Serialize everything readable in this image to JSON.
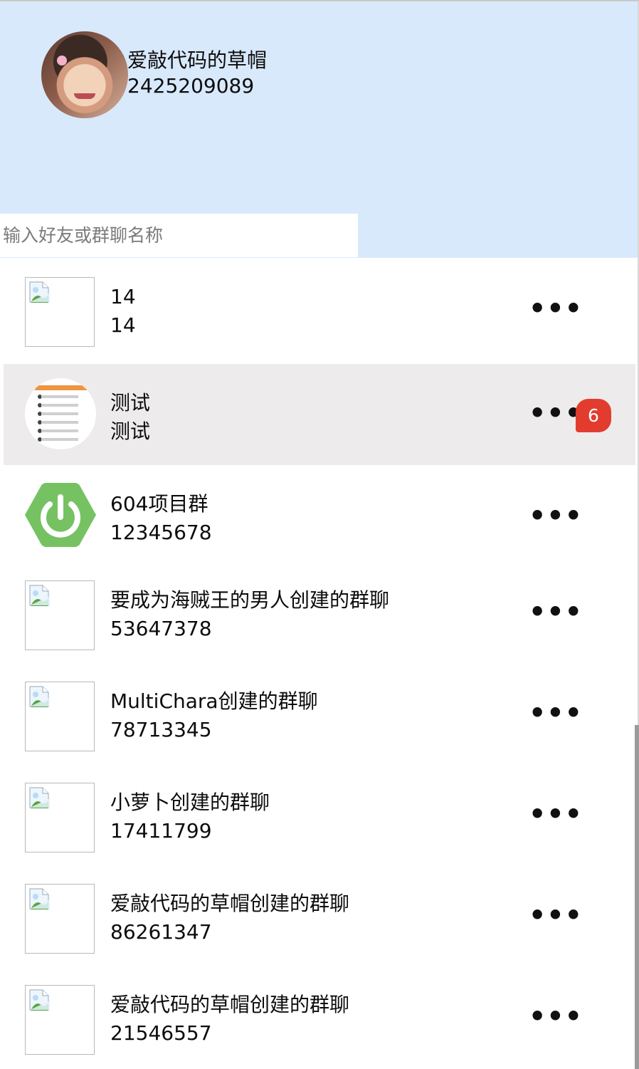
{
  "profile": {
    "name": "爱敲代码的草帽",
    "id": "2425209089"
  },
  "search": {
    "placeholder": "输入好友或群聊名称"
  },
  "colors": {
    "header_background": "#d8e9fb",
    "active_row": "#edebeb",
    "badge": "#e23c2f",
    "spring_green": "#76c262"
  },
  "chats": [
    {
      "title": "14",
      "subtitle": "14",
      "avatar": "broken-image-icon",
      "more": "•••"
    },
    {
      "title": "测试",
      "subtitle": "测试",
      "avatar": "chat-screenshot-avatar",
      "more": "•••",
      "badge": "6",
      "active": true
    },
    {
      "title": "604项目群",
      "subtitle": "12345678",
      "avatar": "spring-power-icon",
      "more": "•••"
    },
    {
      "title": "要成为海贼王的男人创建的群聊",
      "subtitle": "53647378",
      "avatar": "broken-image-icon",
      "more": "•••"
    },
    {
      "title": "MultiChara创建的群聊",
      "subtitle": "78713345",
      "avatar": "broken-image-icon",
      "more": "•••"
    },
    {
      "title": "小萝卜创建的群聊",
      "subtitle": "17411799",
      "avatar": "broken-image-icon",
      "more": "•••"
    },
    {
      "title": "爱敲代码的草帽创建的群聊",
      "subtitle": "86261347",
      "avatar": "broken-image-icon",
      "more": "•••"
    },
    {
      "title": "爱敲代码的草帽创建的群聊",
      "subtitle": "21546557",
      "avatar": "broken-image-icon",
      "more": "•••"
    }
  ]
}
